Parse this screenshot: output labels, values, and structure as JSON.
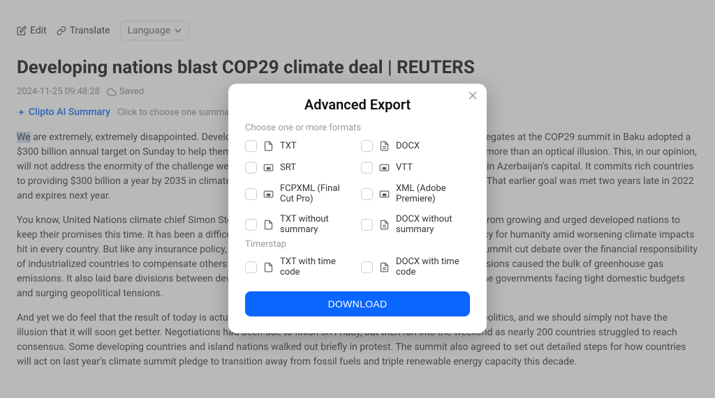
{
  "toolbar": {
    "edit": "Edit",
    "translate": "Translate",
    "language": "Language"
  },
  "article": {
    "title": "Developing nations blast COP29 climate deal | REUTERS",
    "timestamp": "2024-11-25 09:48:28",
    "saved_status": "Saved",
    "ai_summary_link": "Clipto AI Summary",
    "ai_summary_hint": "Click to choose one summary",
    "body_highlight_prefix": "We",
    "p1_rest": " are extremely, extremely disappointed. Developing countries reacted angrily to a new global target, as delegates at the COP29 summit in Baku adopted a $300 billion annual target on Sunday to help them deal with the impacts of climate change, calling it nothing more than an optical illusion. This, in our opinion, will not address the enormity of the challenge we all face. The deal was reached at the two-week conference in Azerbaijan's capital. It commits rich countries to providing $300 billion a year by 2035 in climate finance, up from $100 billion committed annually by 2020. That earlier goal was met two years late in 2022 and expires next year.",
    "p2": " You know, United Nations climate chief Simon Stoltenberg acknowledged the journey and the disagreement from growing and urged developed nations to keep their promises this time. It has been a difficult journey, but we've delivered a deal. It is an insurance policy for humanity amid worsening climate impacts hit in every country. But like any insurance policy, it only works if premiums are paid in full and on time. The summit cut debate over the financial responsibility of industrialized countries to compensate others for worsening climate damage, as they have historical emissions caused the bulk of greenhouse gas emissions. It also laid bare divisions between developing nations reeling from climate-driven disasters and the governments facing tight domestic budgets and surging geopolitical tensions.",
    "p3": " And yet we do feel that the result of today is actually evidence that it has become much harder in global geopolitics, and we should simply not have the illusion that it will soon get better. Negotiations had been due to finish on Friday, but then ran into the weekend as nearly 200 countries struggled to reach consensus. Some developing countries and island nations walked out briefly in protest. The summit also agreed to set out detailed steps for how countries will act on last year's climate summit pledge to transition away from fossil fuels and triple renewable energy capacity this decade."
  },
  "modal": {
    "title": "Advanced Export",
    "section1_label": "Choose one or more formats",
    "section2_label": "Timerstap",
    "formats": {
      "txt": "TXT",
      "docx": "DOCX",
      "srt": "SRT",
      "vtt": "VTT",
      "fcpxml": "FCPXML (Final Cut Pro)",
      "xml_adobe": "XML (Adobe Premiere)",
      "txt_no_summary": "TXT without summary",
      "docx_no_summary": "DOCX without summary",
      "txt_timecode": "TXT with time code",
      "docx_timecode": "DOCX with time code"
    },
    "download": "DOWNLOAD"
  }
}
